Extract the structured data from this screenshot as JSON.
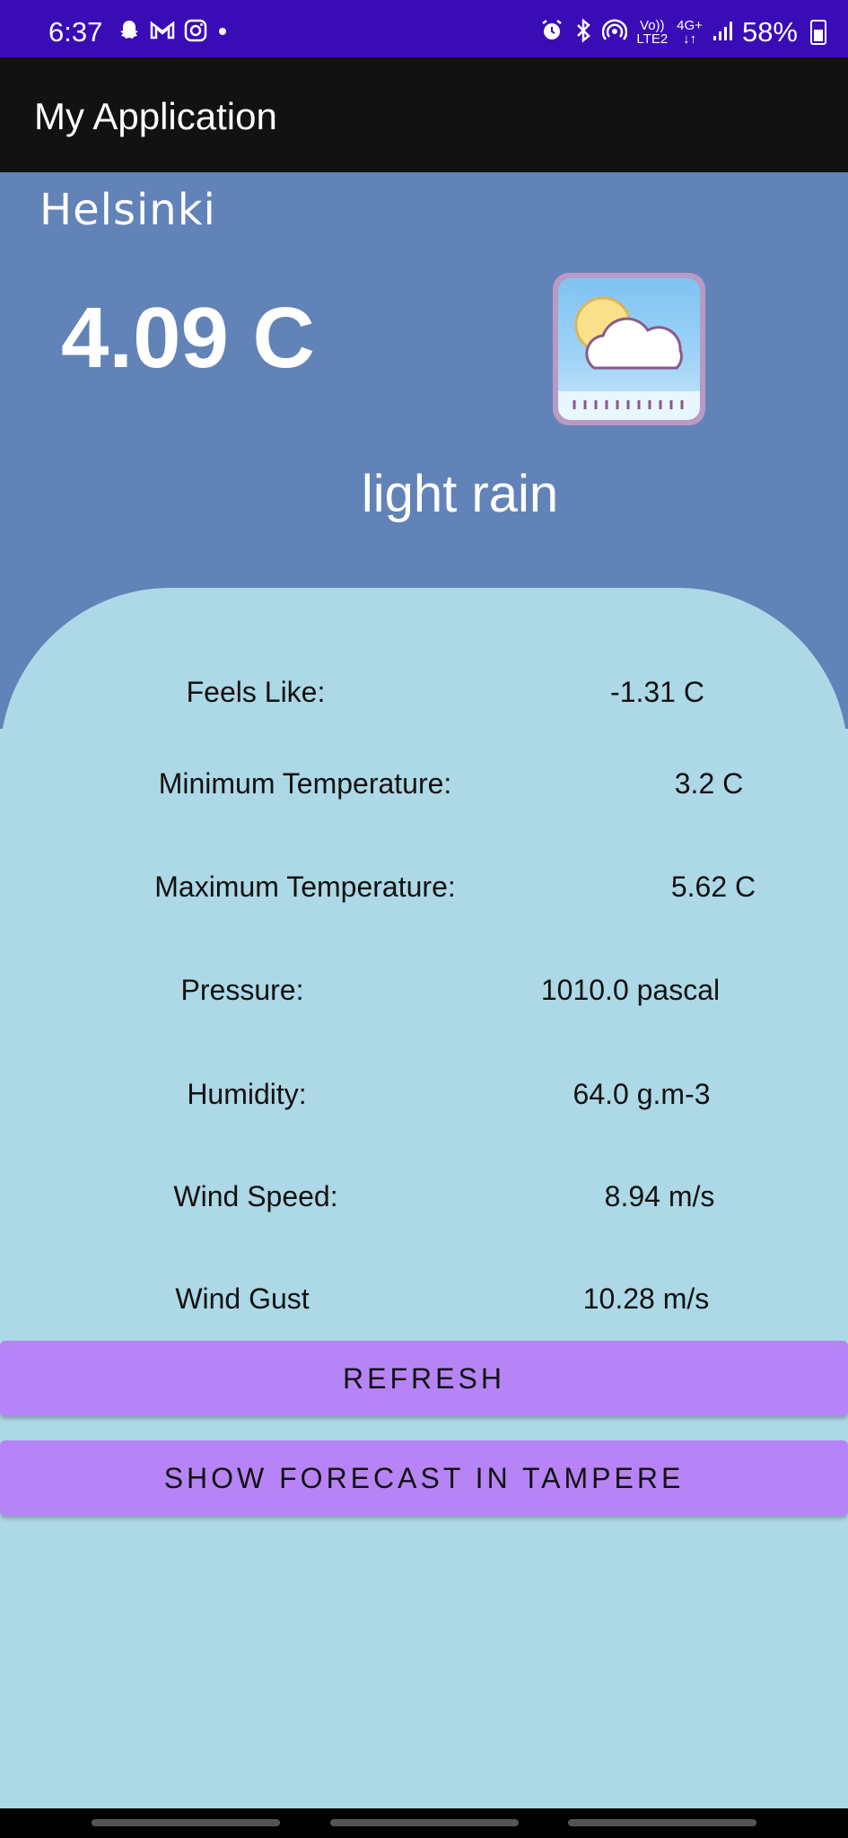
{
  "status_bar": {
    "time": "6:37",
    "network_top": "Vo))",
    "network_bottom": "LTE2",
    "net_type": "4G+",
    "battery": "58%",
    "bg_color": "#3a0cb6"
  },
  "app_bar": {
    "title": "My Application"
  },
  "weather": {
    "city": "Helsinki",
    "temperature": "4.09 C",
    "description": "light rain",
    "icon": "partly-cloudy-icon"
  },
  "details": [
    {
      "label": "Feels Like:",
      "value": "-1.31 C"
    },
    {
      "label": "Minimum Temperature:",
      "value": "3.2 C"
    },
    {
      "label": "Maximum Temperature:",
      "value": "5.62 C"
    },
    {
      "label": "Pressure:",
      "value": "1010.0 pascal"
    },
    {
      "label": "Humidity:",
      "value": "64.0 g.m-3"
    },
    {
      "label": "Wind Speed:",
      "value": "8.94 m/s"
    },
    {
      "label": "Wind Gust",
      "value": "10.28 m/s"
    }
  ],
  "buttons": {
    "refresh": "REFRESH",
    "forecast": "SHOW FORECAST IN TAMPERE"
  },
  "colors": {
    "hero_bg": "#6283b8",
    "details_bg": "#add8e6",
    "button_bg": "#b784f7"
  }
}
